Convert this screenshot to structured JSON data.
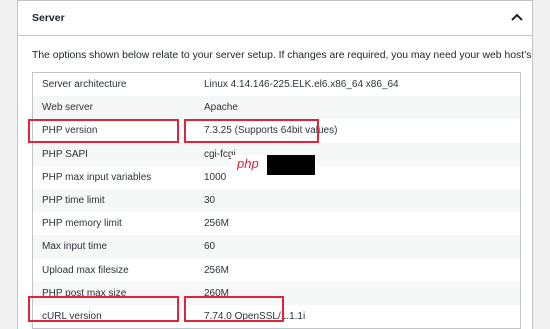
{
  "panel": {
    "title": "Server",
    "toggle_icon": "chevron-up-icon",
    "description": "The options shown below relate to your server setup. If changes are required, you may need your web host’s assistance."
  },
  "rows": [
    {
      "label": "Server architecture",
      "value": "Linux 4.14.146-225.ELK.el6.x86_64 x86_64"
    },
    {
      "label": "Web server",
      "value": "Apache"
    },
    {
      "label": "PHP version",
      "value": "7.3.25 (Supports 64bit values)"
    },
    {
      "label": "PHP SAPI",
      "value": "cgi-fcgi"
    },
    {
      "label": "PHP max input variables",
      "value": "1000"
    },
    {
      "label": "PHP time limit",
      "value": "30"
    },
    {
      "label": "PHP memory limit",
      "value": "256M"
    },
    {
      "label": "Max input time",
      "value": "60"
    },
    {
      "label": "Upload max filesize",
      "value": "256M"
    },
    {
      "label": "PHP post max size",
      "value": "260M"
    },
    {
      "label": "cURL version",
      "value": "7.74.0 OpenSSL/1.1.1i"
    }
  ],
  "watermark": {
    "logo_text": "php"
  },
  "colors": {
    "highlight": "#e0243c",
    "border": "#c3c4c7",
    "row_alt": "#f6f7f7",
    "background": "#f1f1f1"
  }
}
